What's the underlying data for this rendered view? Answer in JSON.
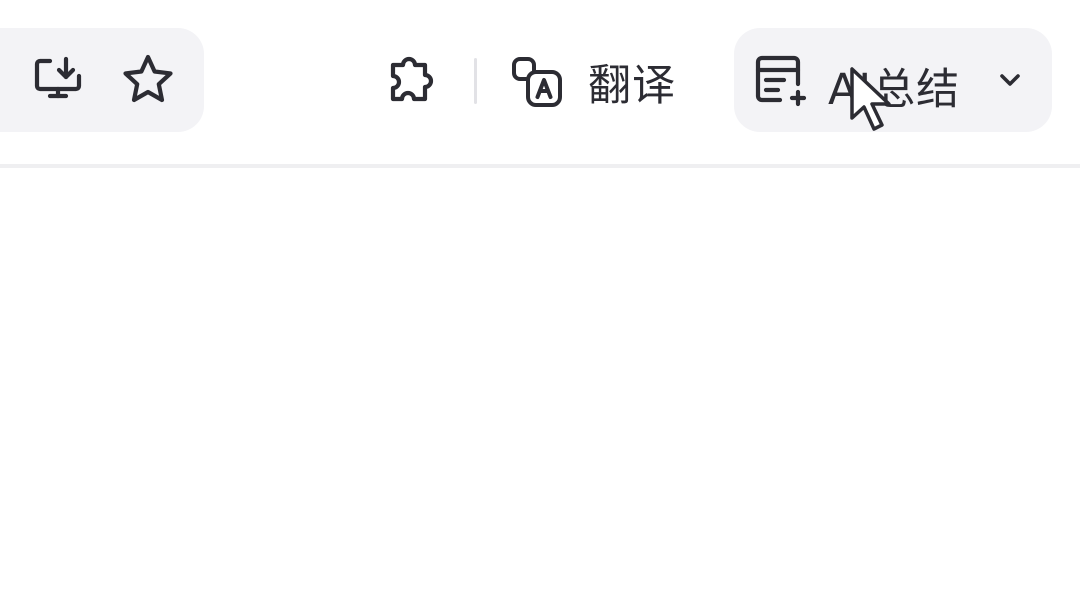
{
  "toolbar": {
    "install_icon": "monitor-download-icon",
    "favorite_icon": "star-icon",
    "extensions_icon": "puzzle-icon",
    "translate": {
      "icon": "translate-icon",
      "label": "翻译"
    },
    "ai_summary": {
      "icon": "summary-document-icon",
      "label": "AI总结",
      "dropdown_icon": "chevron-down-icon"
    }
  },
  "colors": {
    "toolbar_bg": "#ffffff",
    "group_bg": "#f3f3f6",
    "icon_stroke": "#2c2c33",
    "separator": "#e2e2e6"
  }
}
